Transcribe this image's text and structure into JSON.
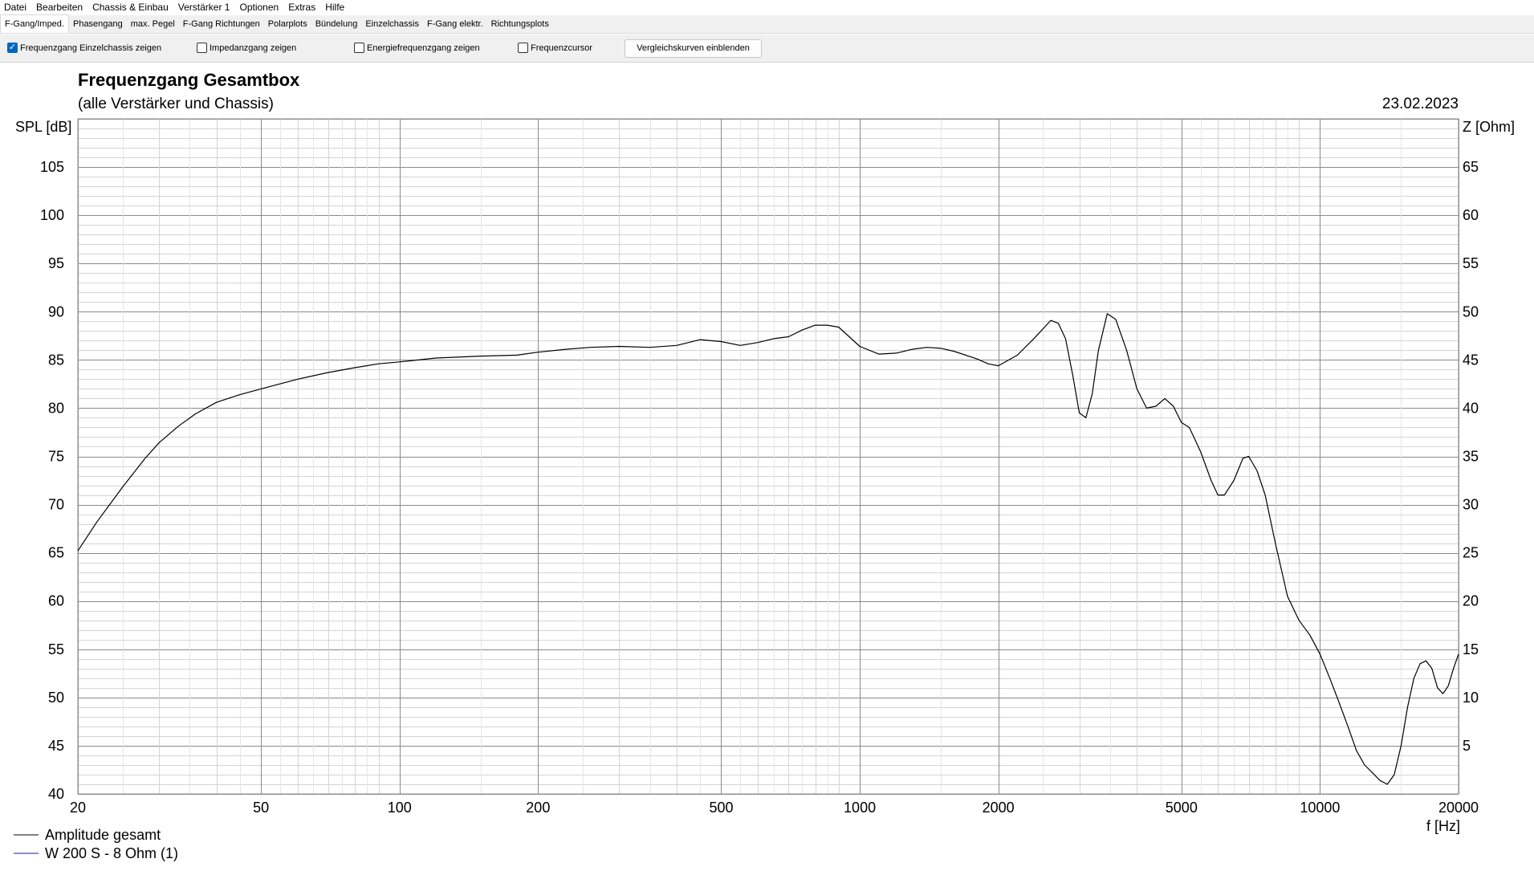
{
  "menu": [
    "Datei",
    "Bearbeiten",
    "Chassis & Einbau",
    "Verstärker 1",
    "Optionen",
    "Extras",
    "Hilfe"
  ],
  "tabs": [
    "F-Gang/Imped.",
    "Phasengang",
    "max. Pegel",
    "F-Gang Richtungen",
    "Polarplots",
    "Bündelung",
    "Einzelchassis",
    "F-Gang elektr.",
    "Richtungsplots"
  ],
  "active_tab": 0,
  "options": {
    "opt1": {
      "label": "Frequenzgang Einzelchassis zeigen",
      "checked": true
    },
    "opt2": {
      "label": "Impedanzgang zeigen",
      "checked": false
    },
    "opt3": {
      "label": "Energiefrequenzgang zeigen",
      "checked": false
    },
    "opt4": {
      "label": "Frequenzcursor",
      "checked": false
    },
    "compare_button": "Vergleichskurven einblenden"
  },
  "chart_data": {
    "type": "line",
    "title": "Frequenzgang Gesamtbox",
    "subtitle": "(alle Verstärker und Chassis)",
    "date": "23.02.2023",
    "ylabel": "SPL [dB]",
    "y2label": "Z [Ohm]",
    "xlabel": "f [Hz]",
    "xscale": "log",
    "xlim": [
      20,
      20000
    ],
    "ylim": [
      40,
      110
    ],
    "y2lim": [
      0,
      70
    ],
    "x_ticks": [
      20,
      50,
      100,
      200,
      500,
      1000,
      2000,
      5000,
      10000,
      20000
    ],
    "y_ticks": [
      40,
      45,
      50,
      55,
      60,
      65,
      70,
      75,
      80,
      85,
      90,
      95,
      100,
      105
    ],
    "y2_ticks": [
      5,
      10,
      15,
      20,
      25,
      30,
      35,
      40,
      45,
      50,
      55,
      60,
      65
    ],
    "grid": true,
    "legend": [
      "Amplitude gesamt",
      "W 200 S - 8 Ohm (1)"
    ],
    "legend_position": "bottom-left",
    "colors": {
      "amplitude": "#000000",
      "chassis": "#1a1aaa"
    },
    "series": [
      {
        "name": "Amplitude gesamt",
        "x": [
          20,
          22,
          25,
          28,
          30,
          33,
          36,
          40,
          45,
          50,
          60,
          70,
          80,
          90,
          100,
          120,
          150,
          180,
          200,
          230,
          260,
          300,
          350,
          400,
          450,
          500,
          550,
          600,
          650,
          700,
          750,
          800,
          850,
          900,
          1000,
          1100,
          1200,
          1300,
          1400,
          1500,
          1600,
          1800,
          1900,
          2000,
          2200,
          2400,
          2600,
          2700,
          2800,
          2900,
          3000,
          3100,
          3200,
          3300,
          3450,
          3600,
          3800,
          4000,
          4200,
          4400,
          4600,
          4800,
          5000,
          5200,
          5500,
          5800,
          6000,
          6200,
          6500,
          6800,
          7000,
          7300,
          7600,
          8000,
          8500,
          9000,
          9500,
          10000,
          10500,
          11000,
          11500,
          12000,
          12500,
          13000,
          13500,
          14000,
          14500,
          15000,
          15500,
          16000,
          16500,
          17000,
          17500,
          18000,
          18500,
          19000,
          19500,
          20000
        ],
        "y": [
          65.2,
          68.2,
          71.8,
          74.8,
          76.4,
          78.1,
          79.4,
          80.6,
          81.4,
          82.0,
          83.0,
          83.7,
          84.2,
          84.6,
          84.8,
          85.2,
          85.4,
          85.5,
          85.8,
          86.1,
          86.3,
          86.4,
          86.3,
          86.5,
          87.1,
          86.9,
          86.5,
          86.8,
          87.2,
          87.4,
          88.1,
          88.6,
          88.6,
          88.4,
          86.4,
          85.6,
          85.7,
          86.1,
          86.3,
          86.2,
          85.9,
          85.1,
          84.6,
          84.4,
          85.5,
          87.3,
          89.1,
          88.8,
          87.2,
          83.5,
          79.5,
          79.0,
          81.5,
          86.0,
          89.8,
          89.2,
          86.0,
          82.0,
          80.0,
          80.2,
          81.0,
          80.2,
          78.5,
          78.0,
          75.5,
          72.5,
          71.0,
          71.0,
          72.5,
          74.8,
          75.0,
          73.5,
          71.0,
          66.0,
          60.5,
          58.0,
          56.5,
          54.5,
          52.0,
          49.5,
          47.0,
          44.5,
          43.0,
          42.2,
          41.4,
          41.0,
          42.0,
          45.0,
          49.0,
          52.0,
          53.5,
          53.8,
          53.0,
          51.0,
          50.4,
          51.2,
          53.0,
          54.5
        ]
      }
    ]
  }
}
